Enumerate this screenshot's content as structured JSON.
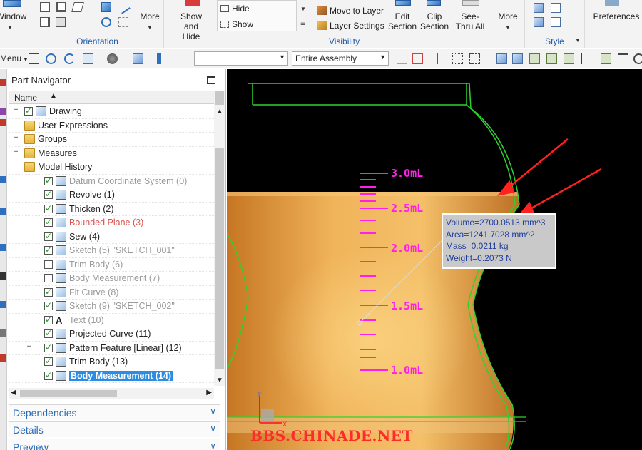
{
  "ribbon": {
    "window_label": "Window",
    "orientation": {
      "label": "Orientation",
      "more_label": "More"
    },
    "visibility": {
      "label": "Visibility",
      "show_and_hide": "Show and Hide",
      "hide": "Hide",
      "show": "Show",
      "move_to_layer": "Move to Layer",
      "layer_settings": "Layer Settings",
      "edit_section": "Edit Section",
      "clip_section": "Clip Section",
      "see_thru_all": "See-Thru All",
      "more_label": "More"
    },
    "style": {
      "label": "Style"
    },
    "preferences": "Preferences"
  },
  "toolbar": {
    "menu_label": "Menu",
    "filter_combo": "",
    "scope_combo": "Entire Assembly"
  },
  "navigator": {
    "title": "Part Navigator",
    "column_name": "Name",
    "items": [
      {
        "label": "Drawing",
        "icon": "drawing-icon",
        "expander": "+",
        "checked": true,
        "state": "normal"
      },
      {
        "label": "User Expressions",
        "icon": "folder-icon",
        "expander": "",
        "checked": null,
        "state": "normal"
      },
      {
        "label": "Groups",
        "icon": "folder-icon",
        "expander": "+",
        "checked": null,
        "state": "normal"
      },
      {
        "label": "Measures",
        "icon": "folder-icon",
        "expander": "+",
        "checked": null,
        "state": "normal"
      },
      {
        "label": "Model History",
        "icon": "folder-icon",
        "expander": "−",
        "checked": null,
        "state": "normal"
      },
      {
        "label": "Datum Coordinate System (0)",
        "icon": "datum-csys-icon",
        "expander": "",
        "checked": true,
        "state": "dim"
      },
      {
        "label": "Revolve (1)",
        "icon": "revolve-icon",
        "expander": "",
        "checked": true,
        "state": "normal"
      },
      {
        "label": "Thicken (2)",
        "icon": "thicken-icon",
        "expander": "",
        "checked": true,
        "state": "normal"
      },
      {
        "label": "Bounded Plane (3)",
        "icon": "bounded-plane-icon",
        "expander": "",
        "checked": true,
        "state": "red"
      },
      {
        "label": "Sew (4)",
        "icon": "sew-icon",
        "expander": "",
        "checked": true,
        "state": "normal"
      },
      {
        "label": "Sketch (5) \"SKETCH_001\"",
        "icon": "sketch-icon",
        "expander": "",
        "checked": true,
        "state": "dim"
      },
      {
        "label": "Trim Body (6)",
        "icon": "trim-body-icon",
        "expander": "",
        "checked": false,
        "state": "dim"
      },
      {
        "label": "Body Measurement (7)",
        "icon": "body-measurement-icon",
        "expander": "",
        "checked": false,
        "state": "dim"
      },
      {
        "label": "Fit Curve (8)",
        "icon": "fit-curve-icon",
        "expander": "",
        "checked": true,
        "state": "dim"
      },
      {
        "label": "Sketch (9) \"SKETCH_002\"",
        "icon": "sketch-icon",
        "expander": "",
        "checked": true,
        "state": "dim"
      },
      {
        "label": "Text (10)",
        "icon": "text-icon",
        "expander": "",
        "checked": true,
        "state": "dim"
      },
      {
        "label": "Projected Curve (11)",
        "icon": "projected-curve-icon",
        "expander": "",
        "checked": true,
        "state": "normal"
      },
      {
        "label": "Pattern Feature [Linear] (12)",
        "icon": "pattern-feature-icon",
        "expander": "+",
        "checked": true,
        "state": "normal"
      },
      {
        "label": "Trim Body (13)",
        "icon": "trim-body-icon",
        "expander": "",
        "checked": true,
        "state": "normal"
      },
      {
        "label": "Body Measurement (14)",
        "icon": "body-measurement-icon",
        "expander": "",
        "checked": true,
        "state": "selected"
      }
    ],
    "panels": [
      "Dependencies",
      "Details",
      "Preview"
    ]
  },
  "viewport": {
    "scale_labels": [
      "3.0mL",
      "2.5mL",
      "2.0mL",
      "1.5mL",
      "1.0mL"
    ],
    "measurement": {
      "volume": "Volume=2700.0513 mm^3",
      "area": "Area=1241.7028 mm^2",
      "mass": "Mass=0.0211 kg",
      "weight": "Weight=0.2073 N"
    },
    "axis_labels": {
      "z": "Z",
      "x": "X"
    },
    "watermark": "BBS.CHINADE.NET",
    "colors": {
      "background": "#000000",
      "outline": "#2fd12f",
      "liquid": "#e9a64a",
      "scale": "#ff1fe8",
      "arrow": "#ff2020",
      "label_text": "#1e3c9c",
      "selection": "#2b8ce2",
      "link_blue": "#2a6bb8"
    }
  }
}
